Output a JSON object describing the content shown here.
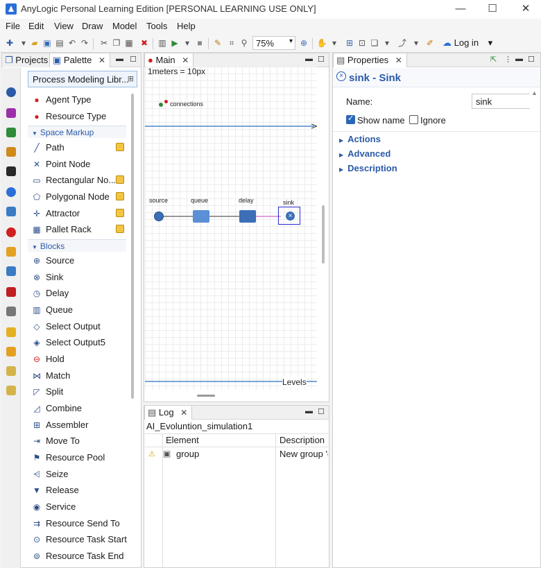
{
  "window": {
    "title": "AnyLogic Personal Learning Edition [PERSONAL LEARNING USE ONLY]",
    "minimize": "—",
    "maximize": "☐",
    "close": "✕"
  },
  "menu": [
    "File",
    "Edit",
    "View",
    "Draw",
    "Model",
    "Tools",
    "Help"
  ],
  "toolbar": {
    "zoom": "75%",
    "login": "Log in"
  },
  "tabs": {
    "projects": "Projects",
    "palette": "Palette",
    "main": "Main",
    "properties": "Properties",
    "log": "Log"
  },
  "palette": {
    "library": "Process Modeling Libr...",
    "top_items": [
      "Agent Type",
      "Resource Type"
    ],
    "space_markup_group": "Space Markup",
    "space_markup_items": [
      "Path",
      "Point Node",
      "Rectangular No...",
      "Polygonal Node",
      "Attractor",
      "Pallet Rack"
    ],
    "blocks_group": "Blocks",
    "blocks_items": [
      "Source",
      "Sink",
      "Delay",
      "Queue",
      "Select Output",
      "Select Output5",
      "Hold",
      "Match",
      "Split",
      "Combine",
      "Assembler",
      "Move To",
      "Resource Pool",
      "Seize",
      "Release",
      "Service",
      "Resource Send To",
      "Resource Task Start",
      "Resource Task End"
    ]
  },
  "canvas": {
    "scale": "1meters = 10px",
    "connections": "connections",
    "levels": "Levels",
    "blocks": [
      "source",
      "queue",
      "delay",
      "sink"
    ]
  },
  "log": {
    "model": "AI_Evoluntion_simulation1",
    "columns": [
      "Element",
      "Description"
    ],
    "rows": [
      {
        "element": "group",
        "description": "New group 'g"
      }
    ]
  },
  "properties": {
    "title": "sink - Sink",
    "name_label": "Name:",
    "name_value": "sink",
    "show_name": "Show name",
    "show_name_checked": true,
    "ignore": "Ignore",
    "ignore_checked": false,
    "sections": [
      "Actions",
      "Advanced",
      "Description"
    ]
  },
  "colors": {
    "accent": "#2b5aa8",
    "block": "#3c6fb5",
    "selection": "#2a2ad0",
    "connector_selected": "#c040c0"
  }
}
